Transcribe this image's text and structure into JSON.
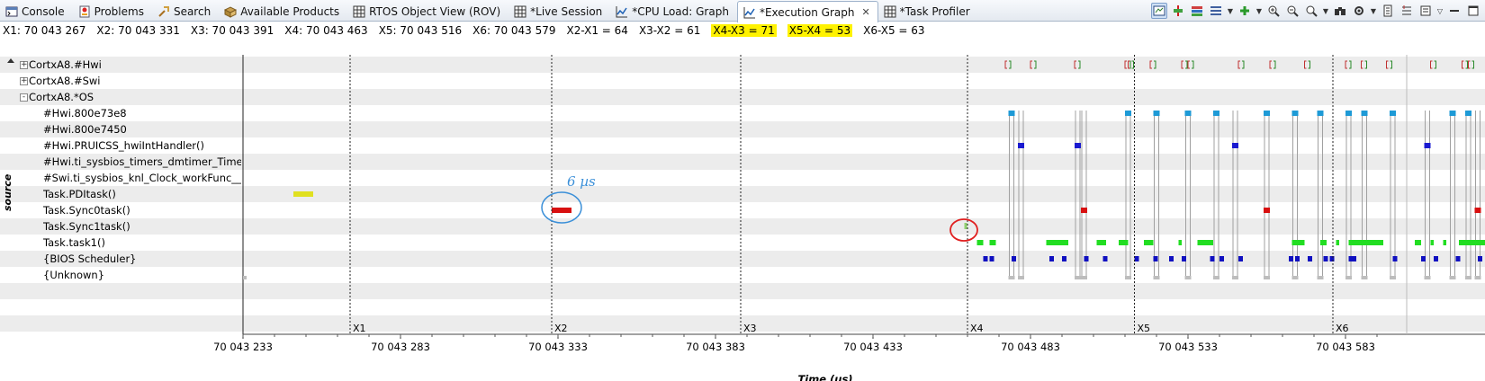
{
  "tabs": [
    {
      "label": "Console",
      "icon": "console-icon",
      "active": false
    },
    {
      "label": "Problems",
      "icon": "problems-icon",
      "active": false
    },
    {
      "label": "Search",
      "icon": "search-icon",
      "active": false
    },
    {
      "label": "Available Products",
      "icon": "products-icon",
      "active": false
    },
    {
      "label": "RTOS Object View (ROV)",
      "icon": "table-icon",
      "active": false
    },
    {
      "label": "*Live Session",
      "icon": "table-icon",
      "active": false
    },
    {
      "label": "*CPU Load: Graph",
      "icon": "graph-icon",
      "active": false
    },
    {
      "label": "*Execution Graph",
      "icon": "graph-icon",
      "active": true
    },
    {
      "label": "*Task Profiler",
      "icon": "table-icon",
      "active": false
    }
  ],
  "marker_info": [
    {
      "text": "X1: 70 043 267",
      "highlight": false
    },
    {
      "text": "X2: 70 043 331",
      "highlight": false
    },
    {
      "text": "X3: 70 043 391",
      "highlight": false
    },
    {
      "text": "X4: 70 043 463",
      "highlight": false
    },
    {
      "text": "X5: 70 043 516",
      "highlight": false
    },
    {
      "text": "X6: 70 043 579",
      "highlight": false
    },
    {
      "text": "X2-X1 = 64",
      "highlight": false
    },
    {
      "text": "X3-X2 = 61",
      "highlight": false
    },
    {
      "text": "X4-X3 = 71",
      "highlight": true
    },
    {
      "text": "X5-X4 = 53",
      "highlight": true
    },
    {
      "text": "X6-X5 = 63",
      "highlight": false
    }
  ],
  "rows": [
    {
      "label": "CortxA8.#Hwi",
      "indent": 0,
      "expander": "+"
    },
    {
      "label": "CortxA8.#Swi",
      "indent": 0,
      "expander": "+"
    },
    {
      "label": "CortxA8.*OS",
      "indent": 0,
      "expander": "-"
    },
    {
      "label": "#Hwi.800e73e8",
      "indent": 1
    },
    {
      "label": "#Hwi.800e7450",
      "indent": 1
    },
    {
      "label": "#Hwi.PRUICSS_hwiIntHandler()",
      "indent": 1
    },
    {
      "label": "#Hwi.ti_sysbios_timers_dmtimer_Timer_stub",
      "indent": 1
    },
    {
      "label": "#Swi.ti_sysbios_knl_Clock_workFunc__E()",
      "indent": 1
    },
    {
      "label": "Task.PDItask()",
      "indent": 1
    },
    {
      "label": "Task.Sync0task()",
      "indent": 1
    },
    {
      "label": "Task.Sync1task()",
      "indent": 1
    },
    {
      "label": "Task.task1()",
      "indent": 1
    },
    {
      "label": "{BIOS Scheduler}",
      "indent": 1
    },
    {
      "label": "{Unknown}",
      "indent": 1
    },
    {
      "label": "",
      "indent": 1
    },
    {
      "label": "",
      "indent": 1
    },
    {
      "label": "",
      "indent": 1
    }
  ],
  "y_axis_label": "source",
  "x_ticks": [
    "70 043 233",
    "70 043 283",
    "70 043 333",
    "70 043 383",
    "70 043 433",
    "70 043 483",
    "70 043 533",
    "70 043 583"
  ],
  "x_axis_label": "Time (us)",
  "annotation_text": "6 µs",
  "colors": {
    "hwi_cyan": "#1e9ad6",
    "hwi_blue": "#1a1ad0",
    "pdi_yellow": "#e0e020",
    "sync0_red": "#d81010",
    "sync1_green": "#90d070",
    "task1_green": "#22dd22",
    "scheduler_blue": "#1010c0",
    "unknown_gray": "#a0a0a0",
    "annotation_blue": "#3a8fd8",
    "annotation_red": "#e02020"
  },
  "chart_data": {
    "type": "execution-timeline",
    "x_axis": {
      "label": "Time (us)",
      "min": 70043233,
      "max": 70043602,
      "ticks": [
        70043233,
        70043283,
        70043333,
        70043383,
        70043433,
        70043483,
        70043533,
        70043583
      ]
    },
    "markers": [
      {
        "name": "X1",
        "t": 70043267
      },
      {
        "name": "X2",
        "t": 70043331
      },
      {
        "name": "X3",
        "t": 70043391
      },
      {
        "name": "X4",
        "t": 70043463
      },
      {
        "name": "X5",
        "t": 70043516
      },
      {
        "name": "X6",
        "t": 70043579
      }
    ],
    "events": {
      "hwi_row0": [
        242,
        250,
        264,
        280,
        281,
        288,
        298,
        300,
        316,
        326,
        337,
        350,
        355,
        363,
        377,
        387,
        389,
        401,
        405,
        424
      ],
      "hwi_800e73e8": [
        243,
        280,
        289,
        299,
        308,
        324,
        333,
        341,
        350,
        355,
        364,
        383,
        388,
        405,
        421,
        432,
        441,
        449,
        459,
        480
      ],
      "pruicss": [
        246,
        264,
        314,
        375,
        449,
        466,
        537,
        585
      ],
      "sync0": [
        266,
        324,
        391,
        451,
        461,
        514,
        575
      ],
      "task1_segments": [
        [
          233,
          235
        ],
        [
          237,
          239
        ],
        [
          255,
          262
        ],
        [
          271,
          274
        ],
        [
          278,
          281
        ],
        [
          286,
          289
        ],
        [
          297,
          298
        ],
        [
          303,
          308
        ],
        [
          333,
          337
        ],
        [
          342,
          344
        ],
        [
          347,
          348
        ],
        [
          351,
          362
        ],
        [
          372,
          374
        ],
        [
          377,
          378
        ],
        [
          381,
          382
        ],
        [
          386,
          399
        ],
        [
          409,
          412
        ],
        [
          417,
          426
        ],
        [
          431,
          434
        ],
        [
          438,
          443
        ],
        [
          448,
          449
        ],
        [
          455,
          456
        ],
        [
          459,
          471
        ],
        [
          479,
          491
        ],
        [
          494,
          505
        ],
        [
          516,
          530
        ],
        [
          538,
          547
        ],
        [
          563,
          564
        ],
        [
          579,
          588
        ],
        [
          595,
          603
        ]
      ],
      "scheduler": [
        235,
        237,
        244,
        256,
        260,
        267,
        273,
        283,
        289,
        294,
        298,
        307,
        310,
        316,
        332,
        334,
        338,
        343,
        345,
        351,
        352,
        365,
        374,
        378,
        385,
        392,
        395,
        415,
        419,
        427,
        430,
        434,
        439,
        446,
        449,
        451,
        455,
        465,
        468,
        487,
        499,
        501,
        524,
        537,
        541,
        547,
        589,
        594
      ]
    }
  }
}
